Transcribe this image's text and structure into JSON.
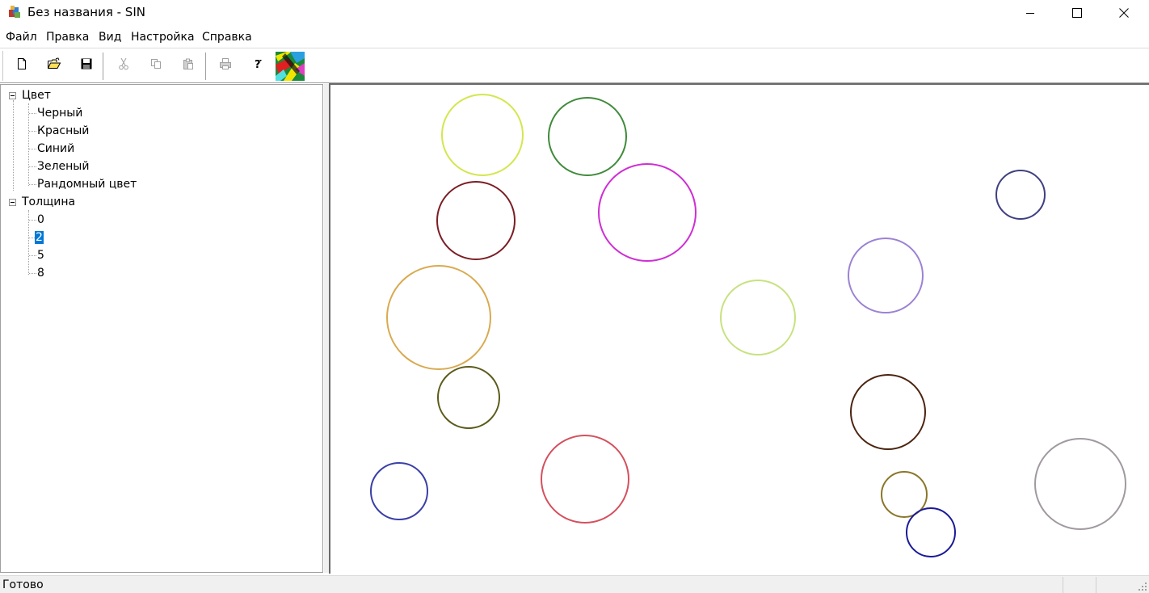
{
  "window": {
    "title": "Без названия - SIN",
    "controls": [
      "minimize-icon",
      "maximize-icon",
      "close-icon"
    ]
  },
  "menu": [
    "Файл",
    "Правка",
    "Вид",
    "Настройка",
    "Справка"
  ],
  "toolbar": {
    "buttons": [
      {
        "name": "new-file-icon",
        "enabled": true
      },
      {
        "name": "open-folder-icon",
        "enabled": true
      },
      {
        "name": "save-icon",
        "enabled": true
      },
      {
        "name": "cut-icon",
        "enabled": false
      },
      {
        "name": "copy-icon",
        "enabled": false
      },
      {
        "name": "paste-icon",
        "enabled": false
      },
      {
        "name": "print-icon",
        "enabled": false
      },
      {
        "name": "help-icon",
        "enabled": true
      },
      {
        "name": "random-color-image-icon",
        "enabled": true
      }
    ]
  },
  "tree": {
    "color": {
      "label": "Цвет",
      "expanded": true,
      "items": [
        "Черный",
        "Красный",
        "Синий",
        "Зеленый",
        "Рандомный цвет"
      ]
    },
    "thickness": {
      "label": "Толщина",
      "expanded": true,
      "items": [
        "0",
        "2",
        "5",
        "8"
      ],
      "selected": "2"
    }
  },
  "canvas": {
    "circle_colors": [
      "#d4e64e",
      "#3f8a3a",
      "#cf2ed4",
      "#7a1e24",
      "#3f3f7f",
      "#9c82d4",
      "#d9aa50",
      "#c7e27f",
      "#5a5a1a",
      "#4a2410",
      "#3a3fa6",
      "#d4505e",
      "#8a7628",
      "#1a1a99",
      "#a09aa0"
    ]
  },
  "status": {
    "text": "Готово"
  }
}
